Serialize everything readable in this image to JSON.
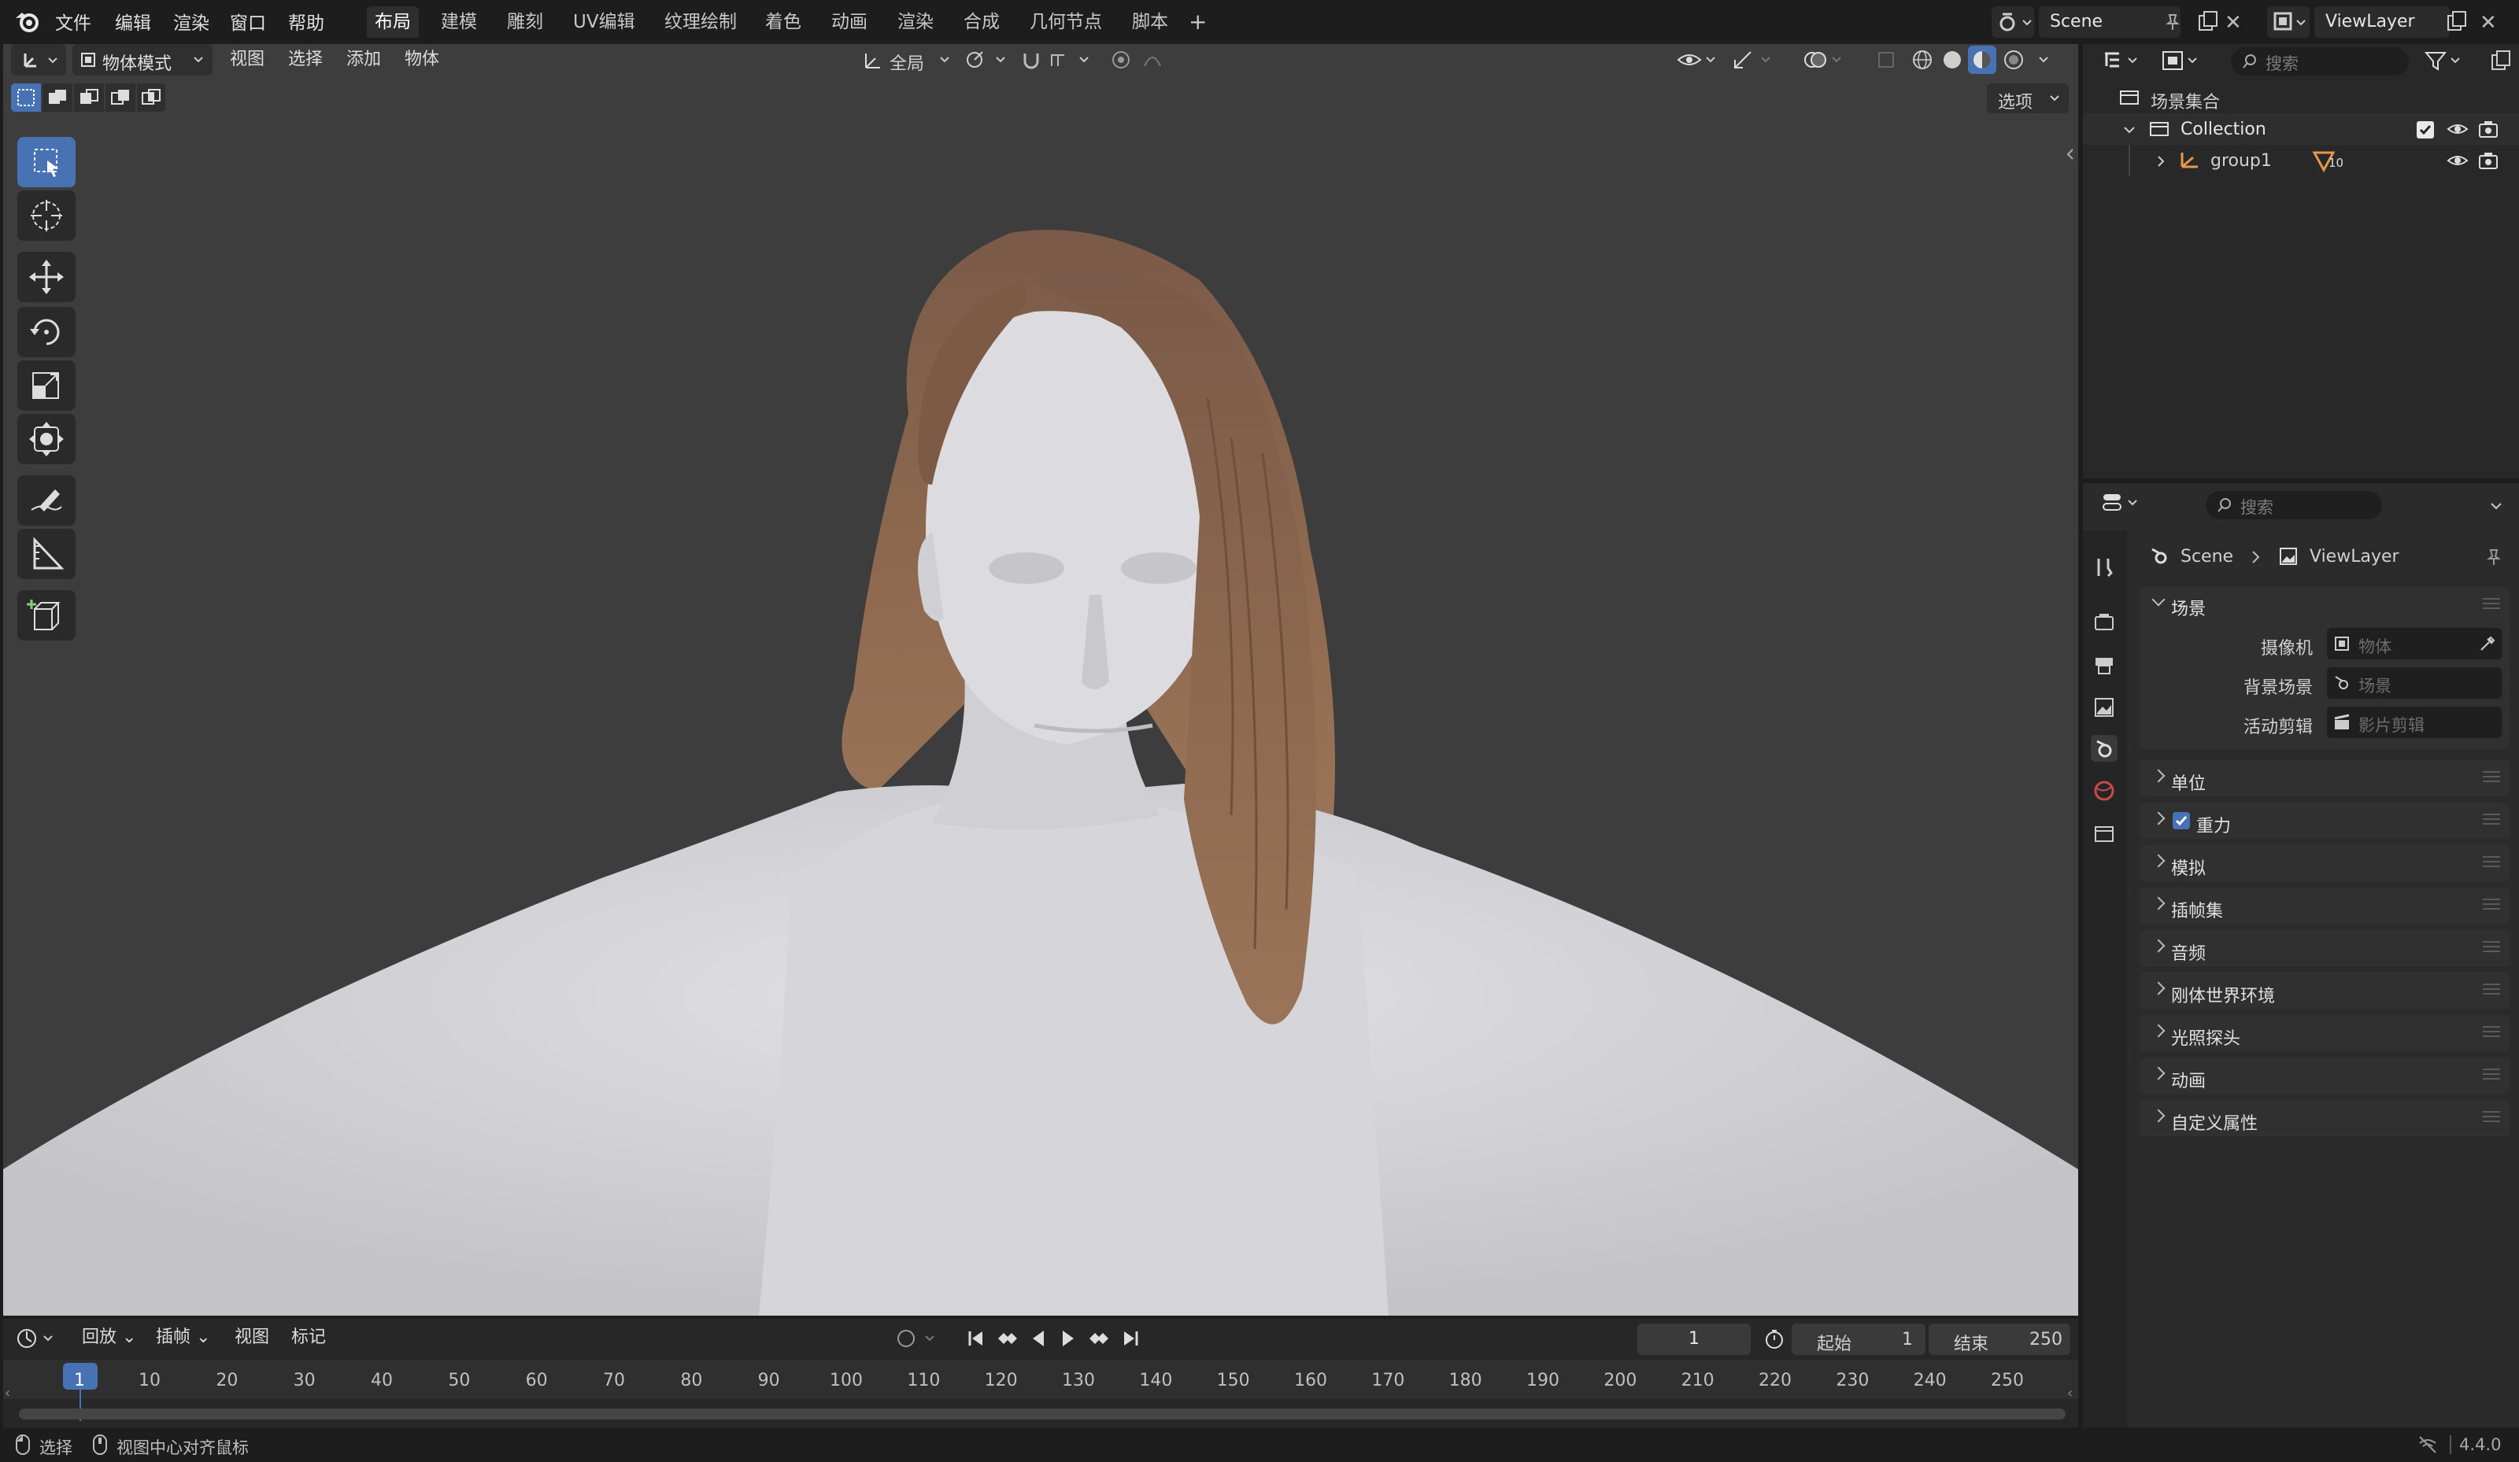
{
  "topbar": {
    "menus": [
      "文件",
      "编辑",
      "渲染",
      "窗口",
      "帮助"
    ],
    "workspaces": [
      "布局",
      "建模",
      "雕刻",
      "UV编辑",
      "纹理绘制",
      "着色",
      "动画",
      "渲染",
      "合成",
      "几何节点",
      "脚本"
    ],
    "active_workspace": "布局",
    "add_tab": "+",
    "scene_name": "Scene",
    "view_layer": "ViewLayer"
  },
  "viewport": {
    "mode": "物体模式",
    "menus": [
      "视图",
      "选择",
      "添加",
      "物体"
    ],
    "orientation": "全局",
    "options": "选项"
  },
  "timeline": {
    "menus": [
      "回放",
      "插帧",
      "视图",
      "标记"
    ],
    "current_frame": "1",
    "start_label": "起始",
    "start": "1",
    "end_label": "结束",
    "end": "250",
    "ruler": [
      "1",
      "10",
      "20",
      "30",
      "40",
      "50",
      "60",
      "70",
      "80",
      "90",
      "100",
      "110",
      "120",
      "130",
      "140",
      "150",
      "160",
      "170",
      "180",
      "190",
      "200",
      "210",
      "220",
      "230",
      "240",
      "250"
    ]
  },
  "outliner": {
    "search_placeholder": "搜索",
    "root": "场景集合",
    "collection": "Collection",
    "object": "group1",
    "object_badge": "10"
  },
  "properties": {
    "search_placeholder": "搜索",
    "breadcrumb": [
      "Scene",
      "ViewLayer"
    ],
    "section": "场景",
    "fields": [
      {
        "label": "摄像机",
        "placeholder": "物体"
      },
      {
        "label": "背景场景",
        "placeholder": "场景"
      },
      {
        "label": "活动剪辑",
        "placeholder": "影片剪辑"
      }
    ],
    "panels": [
      "单位",
      "重力",
      "模拟",
      "插帧集",
      "音频",
      "刚体世界环境",
      "光照探头",
      "动画",
      "自定义属性"
    ],
    "gravity_checked": true
  },
  "statusbar": {
    "select": "选择",
    "center": "视图中心对齐鼠标",
    "version": "4.4.0"
  },
  "colors": {
    "accent": "#4772b3",
    "viewport_bg": "#3d3d3d",
    "skin": "#d2d2d6",
    "hair": "#8a6248"
  }
}
